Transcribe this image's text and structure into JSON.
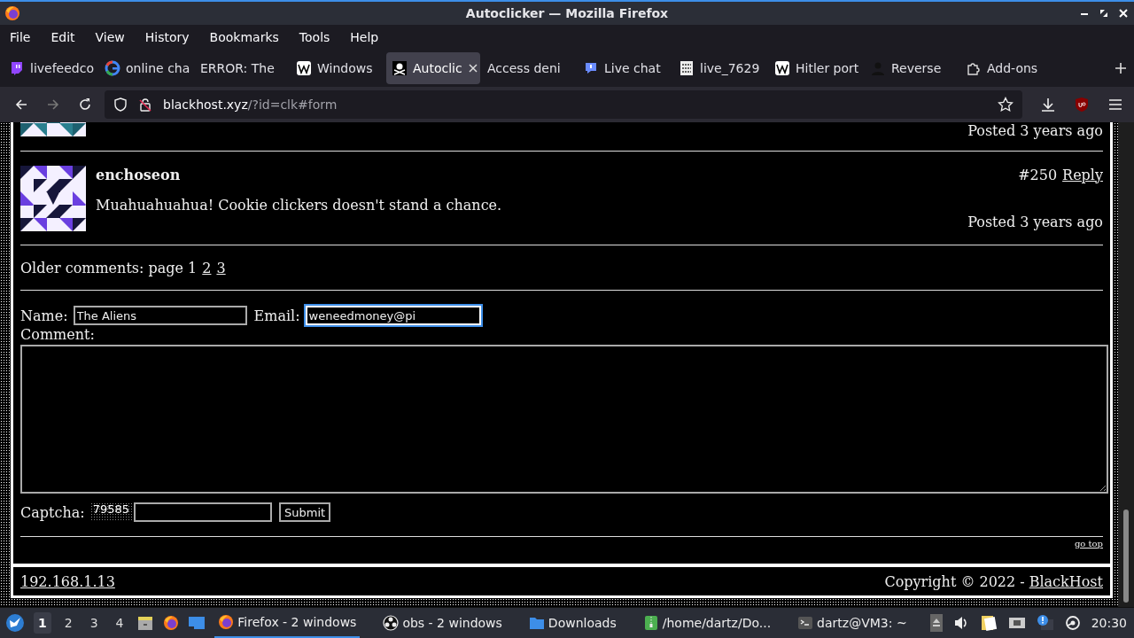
{
  "window": {
    "title": "Autoclicker — Mozilla Firefox"
  },
  "menu": [
    "File",
    "Edit",
    "View",
    "History",
    "Bookmarks",
    "Tools",
    "Help"
  ],
  "tabs": [
    {
      "label": "livefeedco",
      "kind": "twitch",
      "selected": false
    },
    {
      "label": "online cha",
      "kind": "google",
      "selected": false
    },
    {
      "label": "ERROR: The",
      "kind": "plain",
      "selected": false
    },
    {
      "label": "Windows",
      "kind": "wiki",
      "selected": false
    },
    {
      "label": "Autoclic",
      "kind": "pirate",
      "selected": true
    },
    {
      "label": "Access deni",
      "kind": "plain",
      "selected": false
    },
    {
      "label": "Live chat",
      "kind": "chat",
      "selected": false
    },
    {
      "label": "live_7629",
      "kind": "binary",
      "selected": false
    },
    {
      "label": "Hitler port",
      "kind": "wiki",
      "selected": false
    },
    {
      "label": "Reverse",
      "kind": "person",
      "selected": false
    },
    {
      "label": "Add-ons",
      "kind": "puzzle",
      "selected": false
    }
  ],
  "toolbar": {
    "url_domain": "blackhost.xyz",
    "url_path": "/?id=clk#form"
  },
  "page": {
    "previous_comment": {
      "posted": "Posted 3 years ago"
    },
    "comment": {
      "author": "enchoseon",
      "number": "#250",
      "reply": "Reply",
      "text": "Muahuahuahua! Cookie clickers doesn't stand a chance.",
      "posted": "Posted 3 years ago"
    },
    "pagination": {
      "label": "Older comments: page 1",
      "pages": [
        "2",
        "3"
      ]
    },
    "form": {
      "name_label": "Name:",
      "name_value": "The Aliens",
      "email_label": "Email:",
      "email_value": "weneedmoney@pi",
      "email_focused": true,
      "comment_label": "Comment:",
      "captcha_label": "Captcha:",
      "captcha_code": "79585",
      "submit": "Submit"
    },
    "go_top": "go top"
  },
  "footer": {
    "address": "192.168.1.13",
    "copyright": "Copyright © 2022 -",
    "brand": "BlackHost"
  },
  "taskbar": {
    "workspaces": [
      {
        "label": "1",
        "selected": true
      },
      {
        "label": "2",
        "selected": false
      },
      {
        "label": "3",
        "selected": false
      },
      {
        "label": "4",
        "selected": false
      }
    ],
    "tasks": [
      {
        "label": "Firefox - 2 windows",
        "kind": "firefox",
        "selected": true
      },
      {
        "label": "obs - 2 windows",
        "kind": "obs",
        "selected": false
      },
      {
        "label": "Downloads",
        "kind": "folder",
        "selected": false
      },
      {
        "label": "/home/dartz/Do...",
        "kind": "archive",
        "selected": false
      },
      {
        "label": "dartz@VM3: ~",
        "kind": "terminal",
        "selected": false
      }
    ],
    "clock": "20:30"
  }
}
